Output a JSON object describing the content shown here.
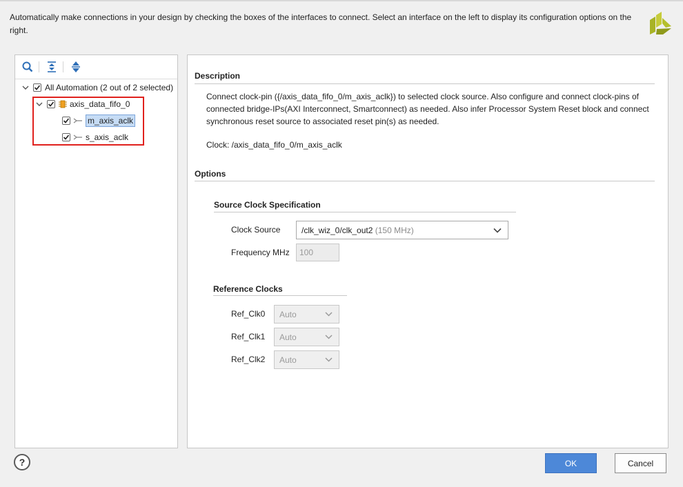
{
  "intro_text": "Automatically make connections in your design by checking the boxes of the interfaces to connect. Select an interface on the left to display its configuration options on the right.",
  "toolbar": {
    "icons": [
      "search-icon",
      "collapse-all-icon",
      "expand-all-icon"
    ]
  },
  "tree": {
    "root": {
      "label": "All Automation (2 out of 2 selected)",
      "checked": true,
      "expanded": true
    },
    "ip": {
      "label": "axis_data_fifo_0",
      "checked": true,
      "expanded": true,
      "icon": "ip-block-icon"
    },
    "children": [
      {
        "label": "m_axis_aclk",
        "checked": true,
        "selected": true,
        "icon": "clock-pin-icon"
      },
      {
        "label": "s_axis_aclk",
        "checked": true,
        "selected": false,
        "icon": "clock-pin-icon"
      }
    ]
  },
  "description": {
    "title": "Description",
    "text": "Connect clock-pin ({/axis_data_fifo_0/m_axis_aclk}) to selected clock source. Also configure and connect clock-pins of connected bridge-IPs(AXI Interconnect, Smartconnect) as needed. Also infer Processor System Reset block and connect synchronous reset source to associated reset pin(s) as needed.",
    "clock_line": "Clock: /axis_data_fifo_0/m_axis_aclk"
  },
  "options": {
    "title": "Options",
    "source_clock": {
      "title": "Source Clock Specification",
      "clock_source_label": "Clock Source",
      "clock_source_value": "/clk_wiz_0/clk_out2",
      "clock_source_freq": "(150 MHz)",
      "frequency_label": "Frequency MHz",
      "frequency_value": "100"
    },
    "reference_clocks": {
      "title": "Reference Clocks",
      "items": [
        {
          "label": "Ref_Clk0",
          "value": "Auto"
        },
        {
          "label": "Ref_Clk1",
          "value": "Auto"
        },
        {
          "label": "Ref_Clk2",
          "value": "Auto"
        }
      ]
    }
  },
  "buttons": {
    "help": "?",
    "ok": "OK",
    "cancel": "Cancel"
  },
  "colors": {
    "ok_button": "#4d88d8",
    "highlight": "#e0201c",
    "selection": "#c6dcf5"
  }
}
